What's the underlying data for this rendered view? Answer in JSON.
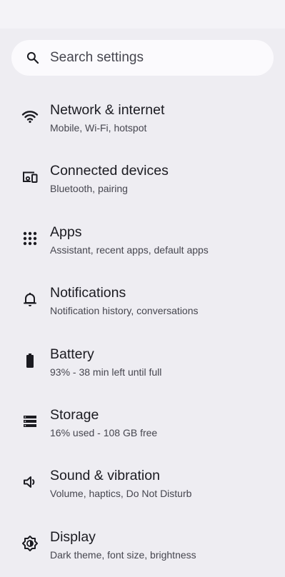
{
  "search": {
    "placeholder": "Search settings",
    "icon": "search-icon"
  },
  "items": [
    {
      "icon": "wifi-icon",
      "title": "Network & internet",
      "subtitle": "Mobile, Wi-Fi, hotspot"
    },
    {
      "icon": "connected-devices-icon",
      "title": "Connected devices",
      "subtitle": "Bluetooth, pairing"
    },
    {
      "icon": "apps-icon",
      "title": "Apps",
      "subtitle": "Assistant, recent apps, default apps"
    },
    {
      "icon": "bell-icon",
      "title": "Notifications",
      "subtitle": "Notification history, conversations"
    },
    {
      "icon": "battery-icon",
      "title": "Battery",
      "subtitle": "93% - 38 min left until full"
    },
    {
      "icon": "storage-icon",
      "title": "Storage",
      "subtitle": "16% used - 108 GB free"
    },
    {
      "icon": "speaker-icon",
      "title": "Sound & vibration",
      "subtitle": "Volume, haptics, Do Not Disturb"
    },
    {
      "icon": "display-icon",
      "title": "Display",
      "subtitle": "Dark theme, font size, brightness"
    }
  ],
  "colors": {
    "background": "#eeedf2",
    "search_background": "#fbfafd",
    "title_text": "#1b1b21",
    "subtitle_text": "#46464f",
    "icon": "#1b1b21"
  }
}
